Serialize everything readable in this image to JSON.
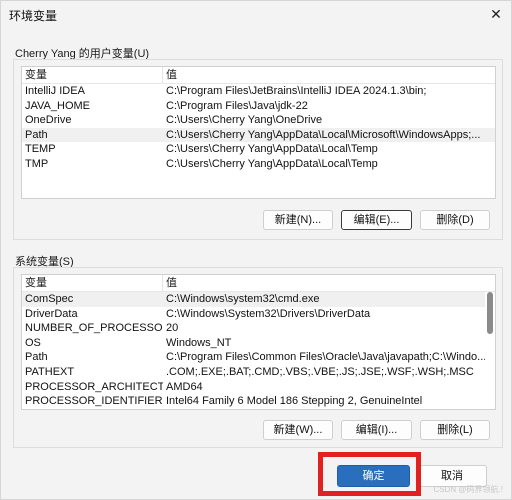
{
  "window": {
    "title": "环境变量",
    "close_glyph": "✕"
  },
  "user_vars": {
    "label": "Cherry Yang 的用户变量(U)",
    "columns": [
      "变量",
      "值"
    ],
    "rows": [
      {
        "name": "IntelliJ IDEA",
        "value": "C:\\Program Files\\JetBrains\\IntelliJ IDEA 2024.1.3\\bin;"
      },
      {
        "name": "JAVA_HOME",
        "value": "C:\\Program Files\\Java\\jdk-22"
      },
      {
        "name": "OneDrive",
        "value": "C:\\Users\\Cherry Yang\\OneDrive"
      },
      {
        "name": "Path",
        "value": "C:\\Users\\Cherry Yang\\AppData\\Local\\Microsoft\\WindowsApps;..."
      },
      {
        "name": "TEMP",
        "value": "C:\\Users\\Cherry Yang\\AppData\\Local\\Temp"
      },
      {
        "name": "TMP",
        "value": "C:\\Users\\Cherry Yang\\AppData\\Local\\Temp"
      }
    ],
    "selected_row": "Path",
    "buttons": {
      "new": "新建(N)...",
      "edit": "编辑(E)...",
      "delete": "删除(D)"
    }
  },
  "system_vars": {
    "label": "系统变量(S)",
    "columns": [
      "变量",
      "值"
    ],
    "rows": [
      {
        "name": "ComSpec",
        "value": "C:\\Windows\\system32\\cmd.exe"
      },
      {
        "name": "DriverData",
        "value": "C:\\Windows\\System32\\Drivers\\DriverData"
      },
      {
        "name": "NUMBER_OF_PROCESSORS",
        "value": "20"
      },
      {
        "name": "OS",
        "value": "Windows_NT"
      },
      {
        "name": "Path",
        "value": "C:\\Program Files\\Common Files\\Oracle\\Java\\javapath;C:\\Windo..."
      },
      {
        "name": "PATHEXT",
        "value": ".COM;.EXE;.BAT;.CMD;.VBS;.VBE;.JS;.JSE;.WSF;.WSH;.MSC"
      },
      {
        "name": "PROCESSOR_ARCHITECTU...",
        "value": "AMD64"
      },
      {
        "name": "PROCESSOR_IDENTIFIER",
        "value": "Intel64 Family 6 Model 186 Stepping 2, GenuineIntel"
      }
    ],
    "selected_row": "ComSpec",
    "buttons": {
      "new": "新建(W)...",
      "edit": "编辑(I)...",
      "delete": "删除(L)"
    }
  },
  "footer": {
    "ok": "确定",
    "cancel": "取消"
  },
  "watermark": "CSDN @码界领航.!",
  "colors": {
    "highlight_border": "#e32020",
    "ok_button": "#2a6ebe",
    "scroll_thumb": "#8a8a8a"
  }
}
